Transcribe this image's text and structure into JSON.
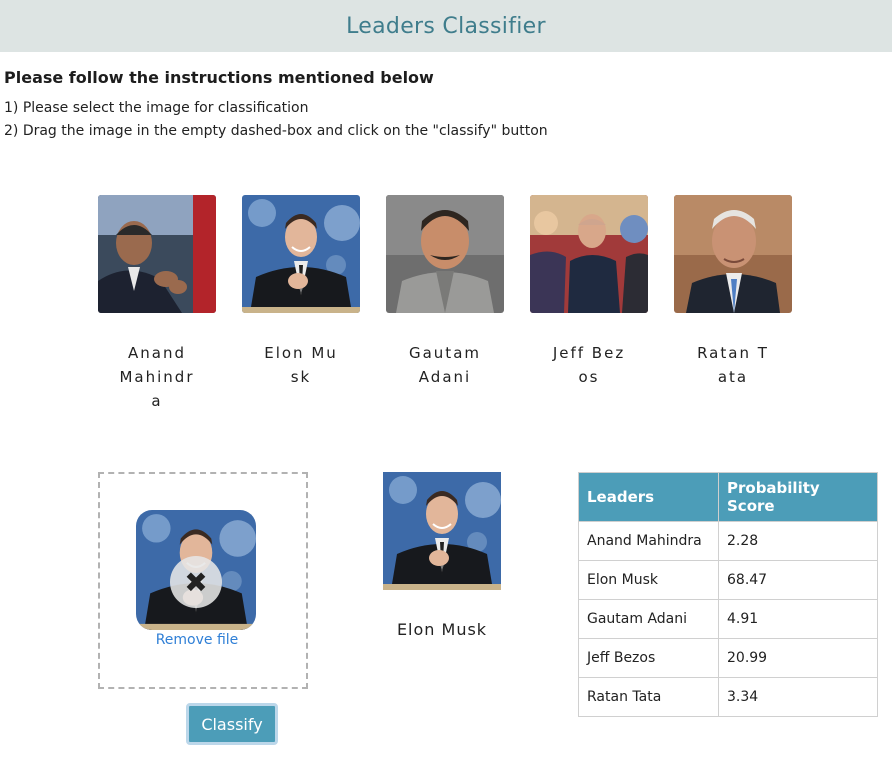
{
  "header": {
    "title": "Leaders Classifier"
  },
  "instructions": {
    "heading": "Please follow the instructions mentioned below",
    "steps": [
      "1) Please select the image for classification",
      "2) Drag the image in the empty dashed-box and click on the \"classify\" button"
    ]
  },
  "leaders": [
    {
      "name": "Anand Mahindra",
      "photo_icon": "anand-mahindra-photo"
    },
    {
      "name": "Elon Musk",
      "photo_icon": "elon-musk-photo"
    },
    {
      "name": "Gautam Adani",
      "photo_icon": "gautam-adani-photo"
    },
    {
      "name": "Jeff Bezos",
      "photo_icon": "jeff-bezos-photo"
    },
    {
      "name": "Ratan Tata",
      "photo_icon": "ratan-tata-photo"
    }
  ],
  "dropzone": {
    "remove_label": "Remove file",
    "remove_icon": "close-icon"
  },
  "classify_button": {
    "label": "Classify"
  },
  "result": {
    "name": "Elon Musk"
  },
  "score_table": {
    "headers": [
      "Leaders",
      "Probability Score"
    ],
    "rows": [
      {
        "leader": "Anand Mahindra",
        "score": "2.28"
      },
      {
        "leader": "Elon Musk",
        "score": "68.47"
      },
      {
        "leader": "Gautam Adani",
        "score": "4.91"
      },
      {
        "leader": "Jeff Bezos",
        "score": "20.99"
      },
      {
        "leader": "Ratan Tata",
        "score": "3.34"
      }
    ]
  },
  "colors": {
    "header_bg": "#dde4e3",
    "title_text": "#3f7d8c",
    "accent": "#4c9db8",
    "link": "#2f7fd6"
  }
}
